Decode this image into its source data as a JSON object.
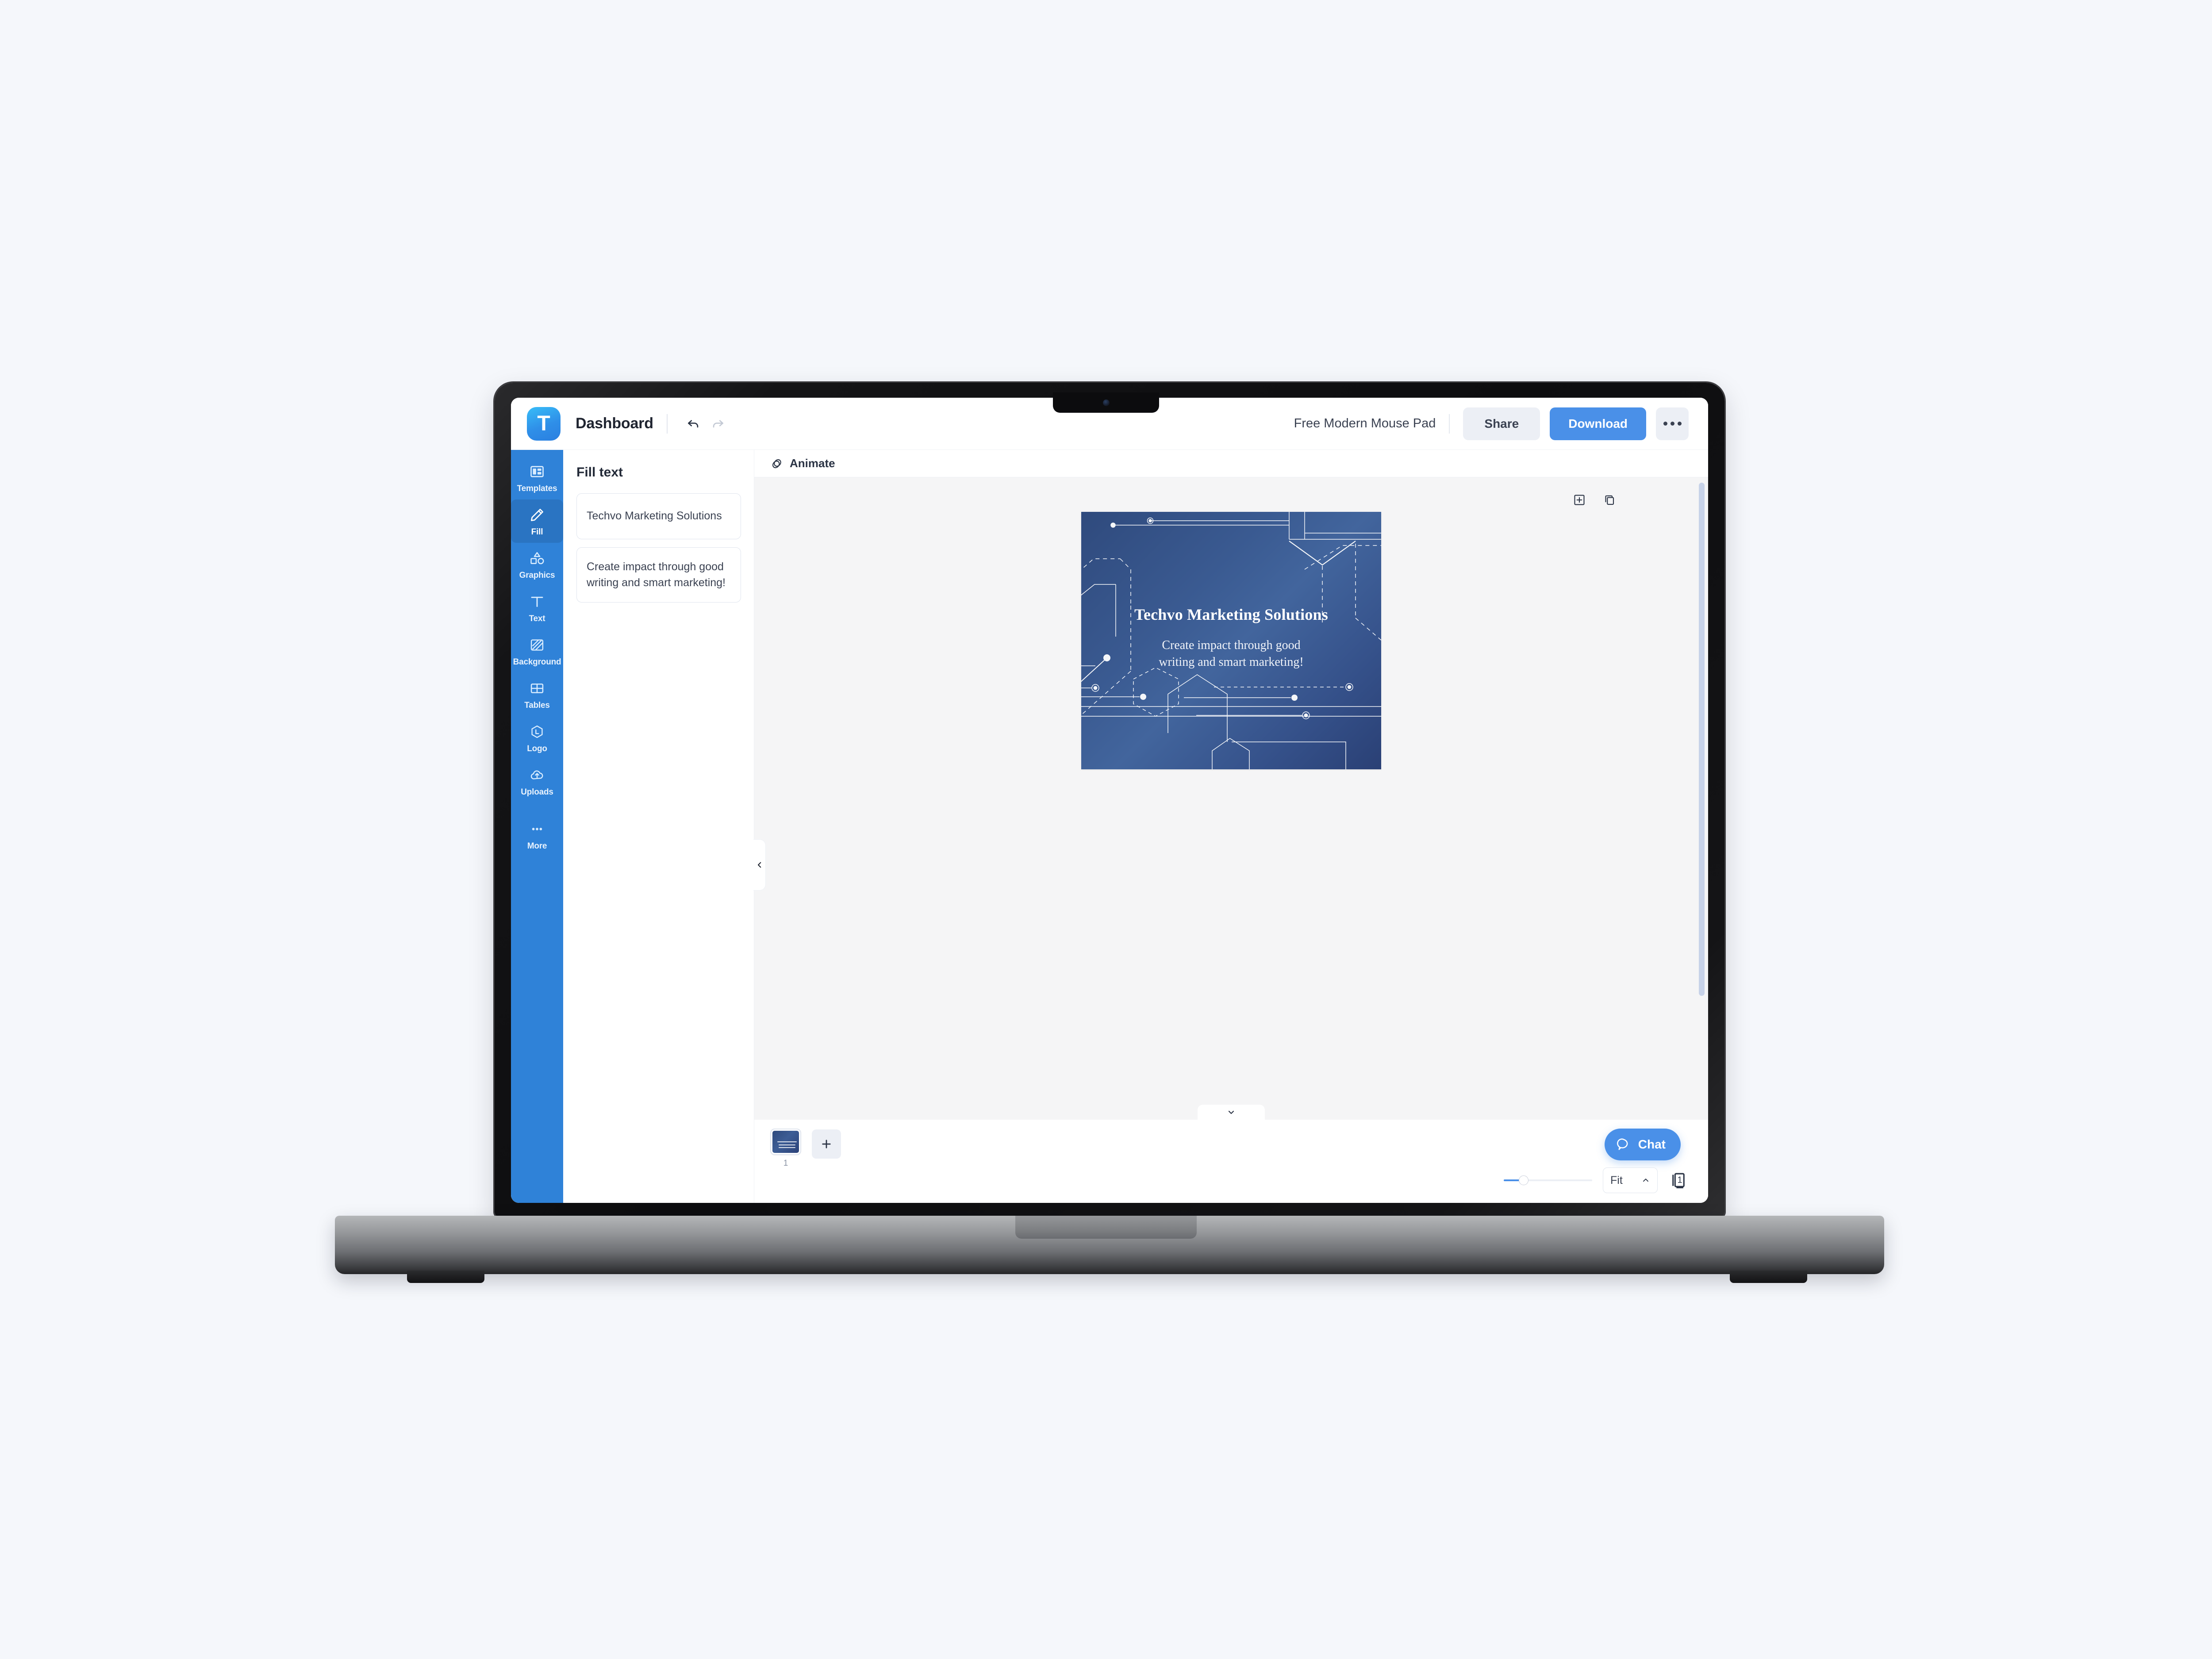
{
  "app": {
    "logo_letter": "T",
    "dashboard_label": "Dashboard",
    "undo_icon": "undo-icon",
    "redo_icon": "redo-icon",
    "document_title": "Free Modern Mouse Pad",
    "share_label": "Share",
    "download_label": "Download",
    "more_options_icon": "ellipsis-icon"
  },
  "rail": {
    "items": [
      {
        "label": "Templates",
        "icon": "templates-icon",
        "active": false
      },
      {
        "label": "Fill",
        "icon": "pencil-icon",
        "active": true
      },
      {
        "label": "Graphics",
        "icon": "shapes-icon",
        "active": false
      },
      {
        "label": "Text",
        "icon": "text-icon",
        "active": false
      },
      {
        "label": "Background",
        "icon": "background-icon",
        "active": false
      },
      {
        "label": "Tables",
        "icon": "table-icon",
        "active": false
      },
      {
        "label": "Logo",
        "icon": "logo-hexagon-icon",
        "active": false
      },
      {
        "label": "Uploads",
        "icon": "upload-cloud-icon",
        "active": false
      },
      {
        "label": "More",
        "icon": "ellipsis-icon",
        "active": false
      }
    ]
  },
  "panel": {
    "title": "Fill text",
    "fields": [
      {
        "value": "Techvo Marketing Solutions"
      },
      {
        "value": "Create impact through good writing and smart marketing!"
      }
    ],
    "collapse_icon": "chevron-left-icon"
  },
  "editor": {
    "animate_label": "Animate",
    "animate_icon": "animate-icon",
    "add_page_icon": "add-square-icon",
    "duplicate_icon": "duplicate-icon",
    "bottom_tab_icon": "chevron-down-icon"
  },
  "slide": {
    "title": "Techvo Marketing Solutions",
    "subtitle_line_1": "Create impact through good",
    "subtitle_line_2": "writing and smart marketing!",
    "background_colors": [
      "#2f4a7d",
      "#42659d",
      "#2a4075"
    ],
    "accent_color": "#ffffff"
  },
  "pages": {
    "thumbnail_number": "1",
    "add_page_icon": "plus-icon"
  },
  "chat": {
    "label": "Chat",
    "icon": "chat-bubble-icon",
    "color": "#4a90e8"
  },
  "zoom": {
    "value_label": "Fit",
    "chevron_icon": "chevron-up-icon",
    "slider_percent": 18,
    "page_count": "1",
    "page_count_icon": "pages-icon"
  }
}
